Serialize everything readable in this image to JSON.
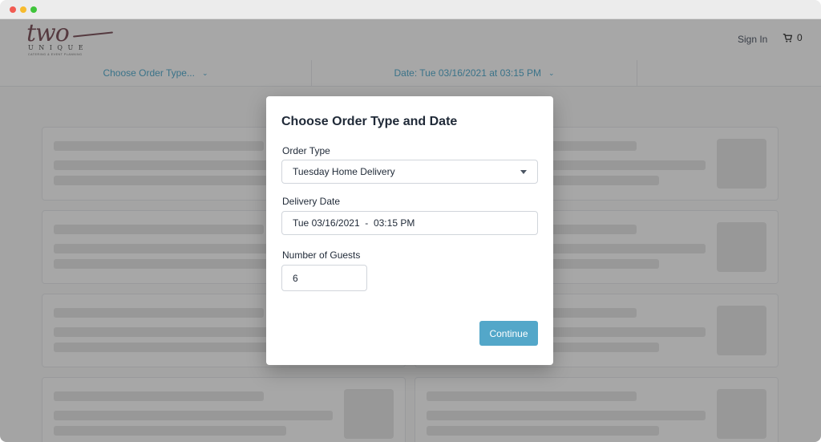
{
  "header": {
    "logo": {
      "script": "two",
      "word": "UNIQUE",
      "tagline": "CATERING & EVENT PLANNING"
    },
    "sign_in": "Sign In",
    "cart_count": "0"
  },
  "subnav": {
    "order_type": "Choose Order Type...",
    "date": "Date: Tue 03/16/2021 at 03:15 PM"
  },
  "modal": {
    "title": "Choose Order Type and Date",
    "order_type_label": "Order Type",
    "order_type_value": "Tuesday Home Delivery",
    "delivery_date_label": "Delivery Date",
    "delivery_date_value": "Tue 03/16/2021  -  03:15 PM",
    "guests_label": "Number of Guests",
    "guests_value": "6",
    "continue_label": "Continue"
  },
  "colors": {
    "accent": "#53a7c9",
    "link": "#3aa0c8",
    "logo": "#6b3a44"
  },
  "icons": {
    "cart": "shopping-cart-icon",
    "chevron": "chevron-down-icon",
    "select": "caret-down-icon"
  }
}
